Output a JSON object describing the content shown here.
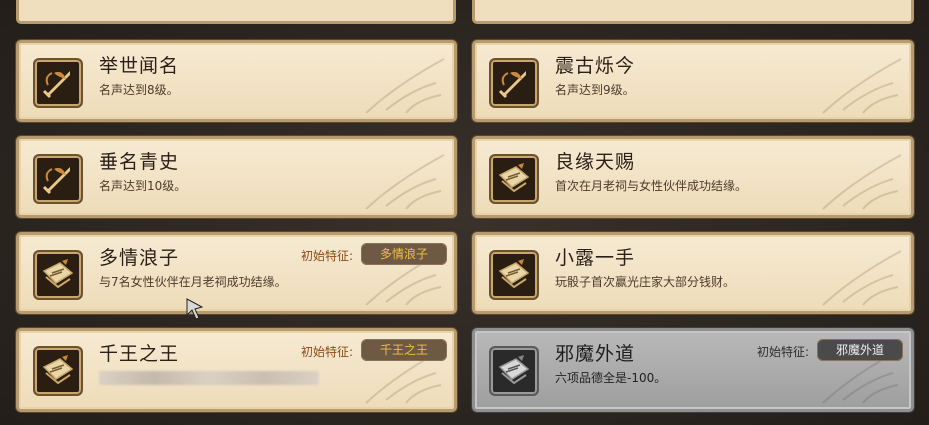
{
  "trait_label": "初始特征:",
  "cards": [
    {
      "title": "举世闻名",
      "desc": "名声达到8级。",
      "icon": "sword-icon"
    },
    {
      "title": "震古烁今",
      "desc": "名声达到9级。",
      "icon": "sword-icon"
    },
    {
      "title": "垂名青史",
      "desc": "名声达到10级。",
      "icon": "sword-icon"
    },
    {
      "title": "良缘天赐",
      "desc": "首次在月老祠与女性伙伴成功结缘。",
      "icon": "scroll-icon"
    },
    {
      "title": "多情浪子",
      "desc": "与7名女性伙伴在月老祠成功结缘。",
      "icon": "scroll-icon",
      "trait": "多情浪子"
    },
    {
      "title": "小露一手",
      "desc": "玩骰子首次赢光庄家大部分钱财。",
      "icon": "scroll-icon"
    },
    {
      "title": "千王之王",
      "desc": "",
      "icon": "scroll-icon",
      "trait": "千王之王"
    },
    {
      "title": "邪魔外道",
      "desc": "六项品德全是-100。",
      "icon": "scroll-icon",
      "trait": "邪魔外道",
      "locked": true
    }
  ],
  "colors": {
    "card": "#f6ead3",
    "card_border": "#b79a6e",
    "trait_text": "#f0c040",
    "grey_card": "#b9b9b9"
  }
}
